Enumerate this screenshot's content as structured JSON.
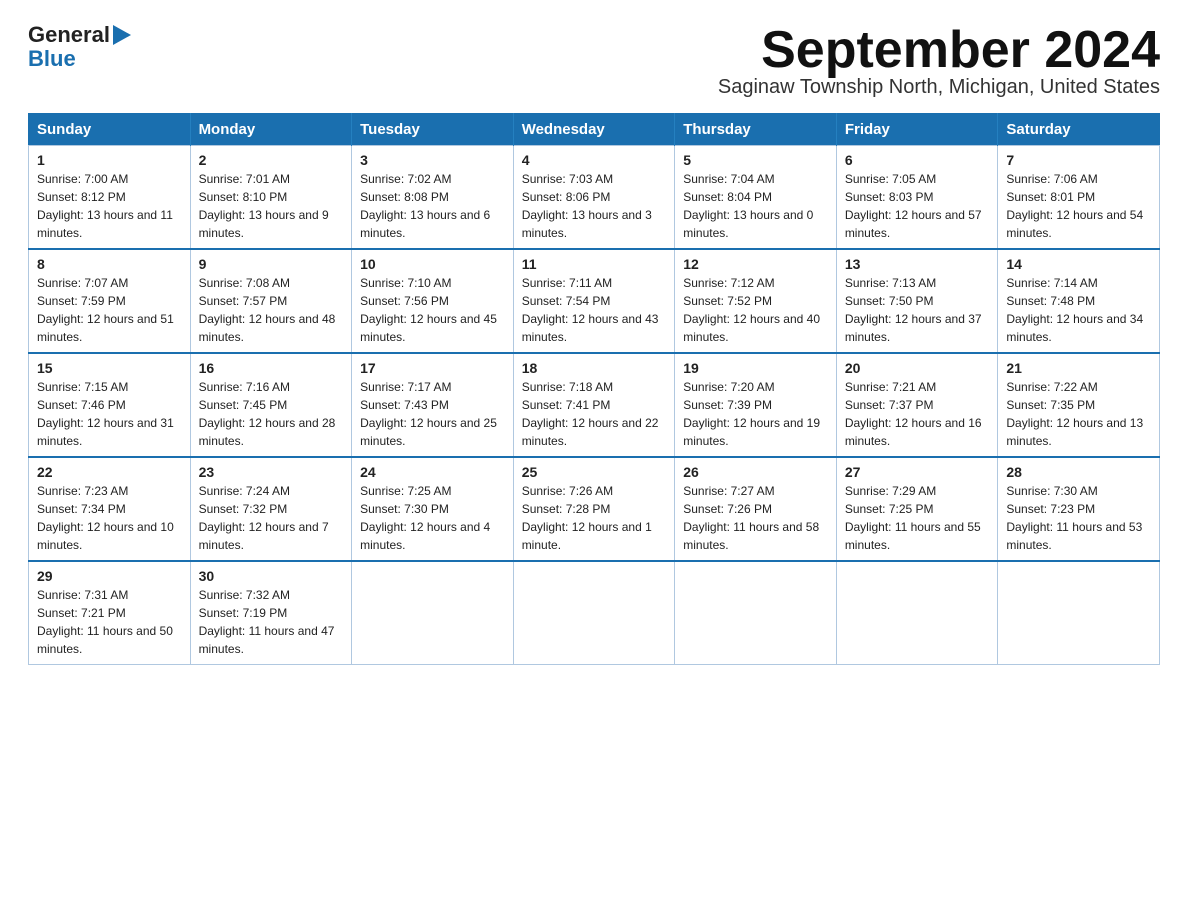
{
  "header": {
    "logo_general": "General",
    "logo_blue": "Blue",
    "month_title": "September 2024",
    "location": "Saginaw Township North, Michigan, United States"
  },
  "weekdays": [
    "Sunday",
    "Monday",
    "Tuesday",
    "Wednesday",
    "Thursday",
    "Friday",
    "Saturday"
  ],
  "weeks": [
    [
      {
        "day": "1",
        "sunrise": "7:00 AM",
        "sunset": "8:12 PM",
        "daylight": "13 hours and 11 minutes."
      },
      {
        "day": "2",
        "sunrise": "7:01 AM",
        "sunset": "8:10 PM",
        "daylight": "13 hours and 9 minutes."
      },
      {
        "day": "3",
        "sunrise": "7:02 AM",
        "sunset": "8:08 PM",
        "daylight": "13 hours and 6 minutes."
      },
      {
        "day": "4",
        "sunrise": "7:03 AM",
        "sunset": "8:06 PM",
        "daylight": "13 hours and 3 minutes."
      },
      {
        "day": "5",
        "sunrise": "7:04 AM",
        "sunset": "8:04 PM",
        "daylight": "13 hours and 0 minutes."
      },
      {
        "day": "6",
        "sunrise": "7:05 AM",
        "sunset": "8:03 PM",
        "daylight": "12 hours and 57 minutes."
      },
      {
        "day": "7",
        "sunrise": "7:06 AM",
        "sunset": "8:01 PM",
        "daylight": "12 hours and 54 minutes."
      }
    ],
    [
      {
        "day": "8",
        "sunrise": "7:07 AM",
        "sunset": "7:59 PM",
        "daylight": "12 hours and 51 minutes."
      },
      {
        "day": "9",
        "sunrise": "7:08 AM",
        "sunset": "7:57 PM",
        "daylight": "12 hours and 48 minutes."
      },
      {
        "day": "10",
        "sunrise": "7:10 AM",
        "sunset": "7:56 PM",
        "daylight": "12 hours and 45 minutes."
      },
      {
        "day": "11",
        "sunrise": "7:11 AM",
        "sunset": "7:54 PM",
        "daylight": "12 hours and 43 minutes."
      },
      {
        "day": "12",
        "sunrise": "7:12 AM",
        "sunset": "7:52 PM",
        "daylight": "12 hours and 40 minutes."
      },
      {
        "day": "13",
        "sunrise": "7:13 AM",
        "sunset": "7:50 PM",
        "daylight": "12 hours and 37 minutes."
      },
      {
        "day": "14",
        "sunrise": "7:14 AM",
        "sunset": "7:48 PM",
        "daylight": "12 hours and 34 minutes."
      }
    ],
    [
      {
        "day": "15",
        "sunrise": "7:15 AM",
        "sunset": "7:46 PM",
        "daylight": "12 hours and 31 minutes."
      },
      {
        "day": "16",
        "sunrise": "7:16 AM",
        "sunset": "7:45 PM",
        "daylight": "12 hours and 28 minutes."
      },
      {
        "day": "17",
        "sunrise": "7:17 AM",
        "sunset": "7:43 PM",
        "daylight": "12 hours and 25 minutes."
      },
      {
        "day": "18",
        "sunrise": "7:18 AM",
        "sunset": "7:41 PM",
        "daylight": "12 hours and 22 minutes."
      },
      {
        "day": "19",
        "sunrise": "7:20 AM",
        "sunset": "7:39 PM",
        "daylight": "12 hours and 19 minutes."
      },
      {
        "day": "20",
        "sunrise": "7:21 AM",
        "sunset": "7:37 PM",
        "daylight": "12 hours and 16 minutes."
      },
      {
        "day": "21",
        "sunrise": "7:22 AM",
        "sunset": "7:35 PM",
        "daylight": "12 hours and 13 minutes."
      }
    ],
    [
      {
        "day": "22",
        "sunrise": "7:23 AM",
        "sunset": "7:34 PM",
        "daylight": "12 hours and 10 minutes."
      },
      {
        "day": "23",
        "sunrise": "7:24 AM",
        "sunset": "7:32 PM",
        "daylight": "12 hours and 7 minutes."
      },
      {
        "day": "24",
        "sunrise": "7:25 AM",
        "sunset": "7:30 PM",
        "daylight": "12 hours and 4 minutes."
      },
      {
        "day": "25",
        "sunrise": "7:26 AM",
        "sunset": "7:28 PM",
        "daylight": "12 hours and 1 minute."
      },
      {
        "day": "26",
        "sunrise": "7:27 AM",
        "sunset": "7:26 PM",
        "daylight": "11 hours and 58 minutes."
      },
      {
        "day": "27",
        "sunrise": "7:29 AM",
        "sunset": "7:25 PM",
        "daylight": "11 hours and 55 minutes."
      },
      {
        "day": "28",
        "sunrise": "7:30 AM",
        "sunset": "7:23 PM",
        "daylight": "11 hours and 53 minutes."
      }
    ],
    [
      {
        "day": "29",
        "sunrise": "7:31 AM",
        "sunset": "7:21 PM",
        "daylight": "11 hours and 50 minutes."
      },
      {
        "day": "30",
        "sunrise": "7:32 AM",
        "sunset": "7:19 PM",
        "daylight": "11 hours and 47 minutes."
      },
      null,
      null,
      null,
      null,
      null
    ]
  ]
}
